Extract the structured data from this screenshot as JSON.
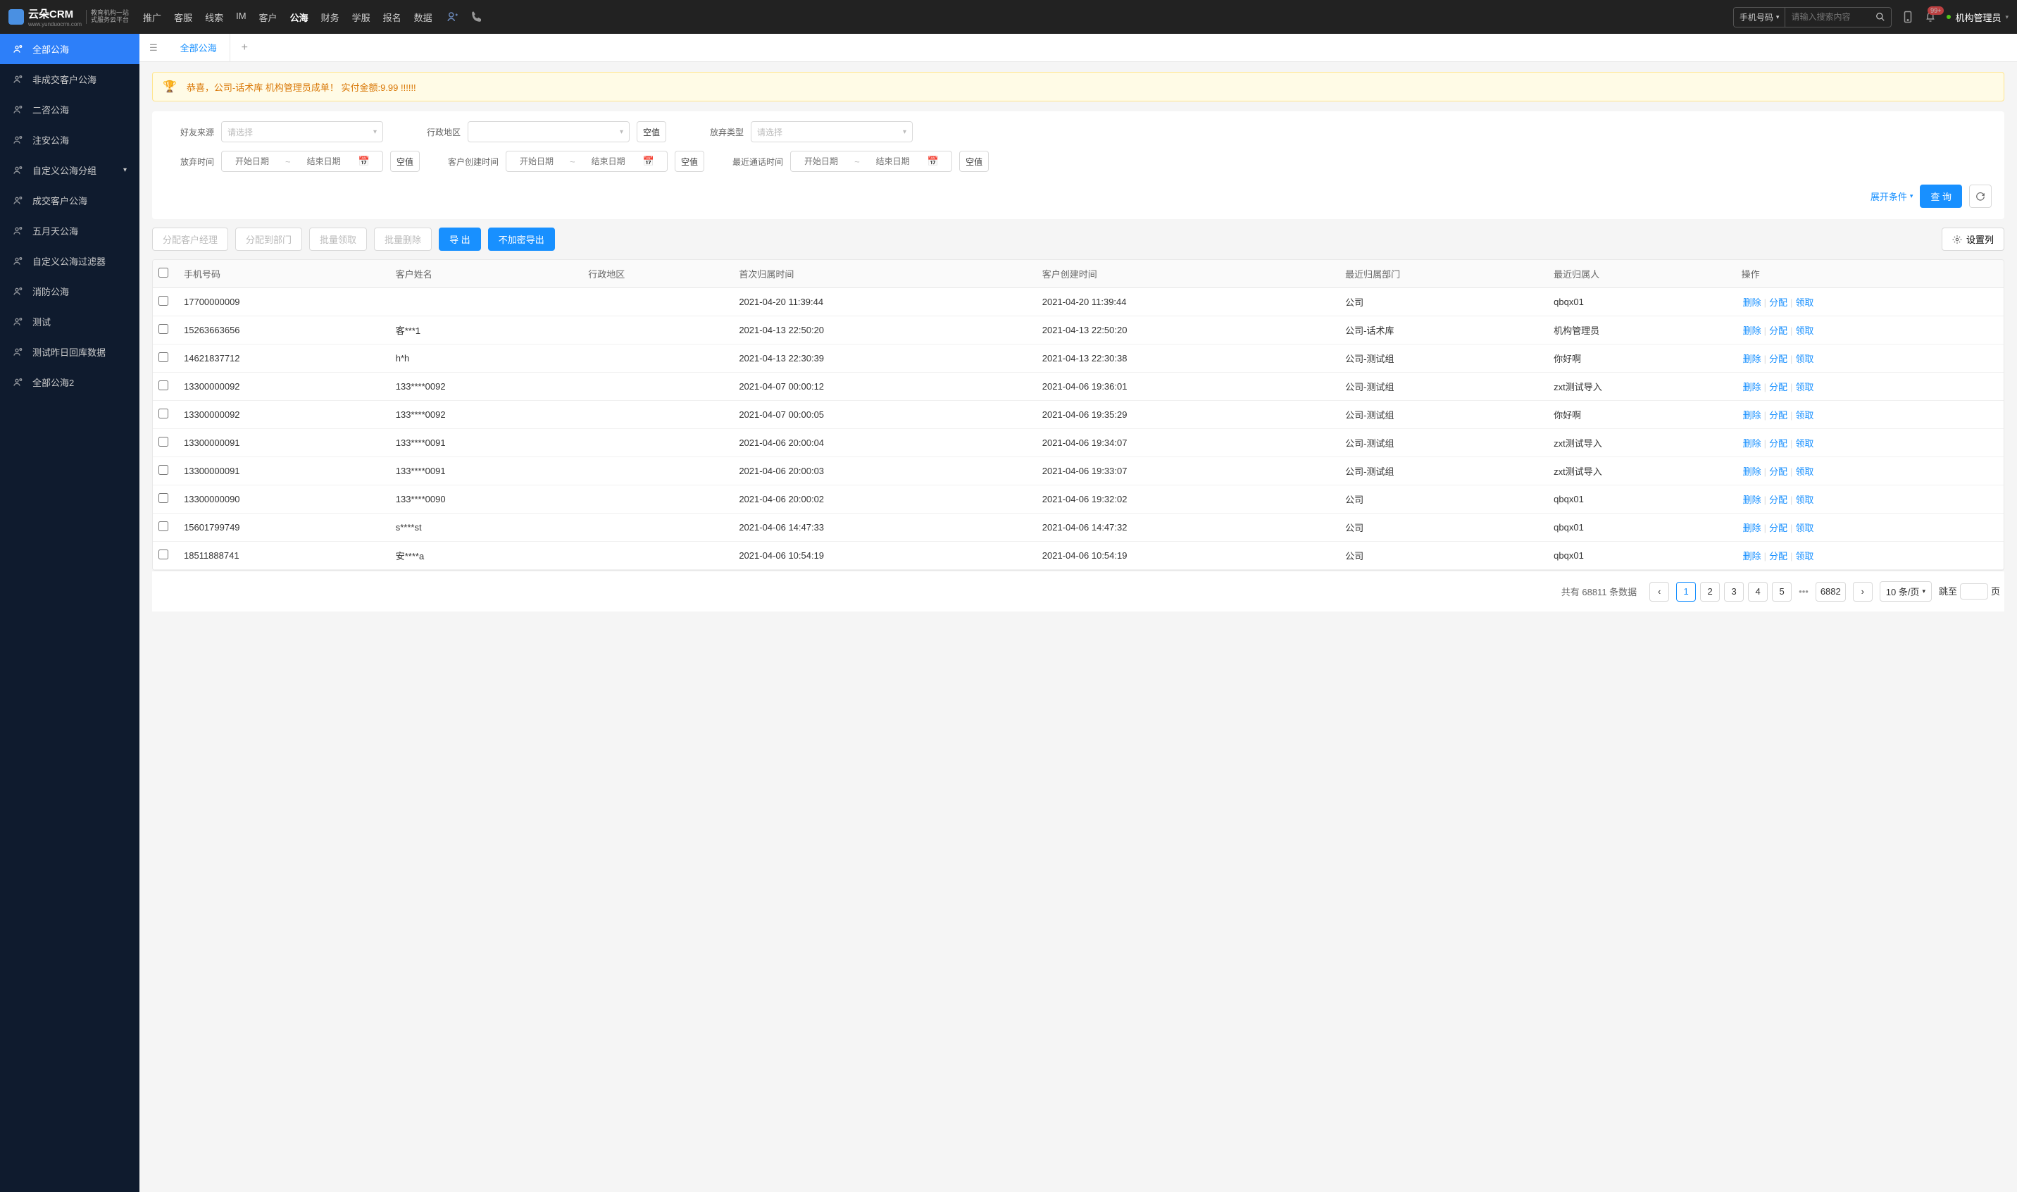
{
  "header": {
    "logo_main": "云朵CRM",
    "logo_sub1": "教育机构一站",
    "logo_sub2": "式服务云平台",
    "logo_url": "www.yunduocrm.com",
    "nav": [
      "推广",
      "客服",
      "线索",
      "IM",
      "客户",
      "公海",
      "财务",
      "学服",
      "报名",
      "数据"
    ],
    "nav_active_index": 5,
    "search_type": "手机号码",
    "search_placeholder": "请输入搜索内容",
    "badge_count": "99+",
    "user_name": "机构管理员"
  },
  "sidebar": [
    {
      "label": "全部公海",
      "active": true
    },
    {
      "label": "非成交客户公海"
    },
    {
      "label": "二咨公海"
    },
    {
      "label": "注安公海"
    },
    {
      "label": "自定义公海分组",
      "has_sub": true
    },
    {
      "label": "成交客户公海"
    },
    {
      "label": "五月天公海"
    },
    {
      "label": "自定义公海过滤器"
    },
    {
      "label": "消防公海"
    },
    {
      "label": "测试"
    },
    {
      "label": "测试昨日回库数据"
    },
    {
      "label": "全部公海2"
    }
  ],
  "tab": {
    "title": "全部公海"
  },
  "alert": "恭喜，公司-话术库  机构管理员成单！  实付金额:9.99 !!!!!!",
  "filters": {
    "friend_source_label": "好友来源",
    "friend_source_ph": "请选择",
    "admin_area_label": "行政地区",
    "admin_area_ph": "",
    "abandon_type_label": "放弃类型",
    "abandon_type_ph": "请选择",
    "abandon_time_label": "放弃时间",
    "create_time_label": "客户创建时间",
    "last_call_label": "最近通话时间",
    "date_start_ph": "开始日期",
    "date_end_ph": "结束日期",
    "null_btn": "空值",
    "expand": "展开条件",
    "query": "查 询"
  },
  "toolbar": {
    "assign_mgr": "分配客户经理",
    "assign_dept": "分配到部门",
    "batch_claim": "批量领取",
    "batch_delete": "批量删除",
    "export": "导 出",
    "export_plain": "不加密导出",
    "set_cols": "设置列"
  },
  "columns": [
    "手机号码",
    "客户姓名",
    "行政地区",
    "首次归属时间",
    "客户创建时间",
    "最近归属部门",
    "最近归属人",
    "操作"
  ],
  "rows": [
    {
      "phone": "17700000009",
      "name": "",
      "area": "",
      "first": "2021-04-20 11:39:44",
      "create": "2021-04-20 11:39:44",
      "dept": "公司",
      "owner": "qbqx01"
    },
    {
      "phone": "15263663656",
      "name": "客***1",
      "area": "",
      "first": "2021-04-13 22:50:20",
      "create": "2021-04-13 22:50:20",
      "dept": "公司-话术库",
      "owner": "机构管理员"
    },
    {
      "phone": "14621837712",
      "name": "h*h",
      "area": "",
      "first": "2021-04-13 22:30:39",
      "create": "2021-04-13 22:30:38",
      "dept": "公司-测试组",
      "owner": "你好啊"
    },
    {
      "phone": "13300000092",
      "name": "133****0092",
      "area": "",
      "first": "2021-04-07 00:00:12",
      "create": "2021-04-06 19:36:01",
      "dept": "公司-测试组",
      "owner": "zxt测试导入"
    },
    {
      "phone": "13300000092",
      "name": "133****0092",
      "area": "",
      "first": "2021-04-07 00:00:05",
      "create": "2021-04-06 19:35:29",
      "dept": "公司-测试组",
      "owner": "你好啊"
    },
    {
      "phone": "13300000091",
      "name": "133****0091",
      "area": "",
      "first": "2021-04-06 20:00:04",
      "create": "2021-04-06 19:34:07",
      "dept": "公司-测试组",
      "owner": "zxt测试导入"
    },
    {
      "phone": "13300000091",
      "name": "133****0091",
      "area": "",
      "first": "2021-04-06 20:00:03",
      "create": "2021-04-06 19:33:07",
      "dept": "公司-测试组",
      "owner": "zxt测试导入"
    },
    {
      "phone": "13300000090",
      "name": "133****0090",
      "area": "",
      "first": "2021-04-06 20:00:02",
      "create": "2021-04-06 19:32:02",
      "dept": "公司",
      "owner": "qbqx01"
    },
    {
      "phone": "15601799749",
      "name": "s****st",
      "area": "",
      "first": "2021-04-06 14:47:33",
      "create": "2021-04-06 14:47:32",
      "dept": "公司",
      "owner": "qbqx01"
    },
    {
      "phone": "18511888741",
      "name": "安****a",
      "area": "",
      "first": "2021-04-06 10:54:19",
      "create": "2021-04-06 10:54:19",
      "dept": "公司",
      "owner": "qbqx01"
    }
  ],
  "ops": {
    "del": "删除",
    "assign": "分配",
    "claim": "领取"
  },
  "pagination": {
    "total_prefix": "共有 ",
    "total": "68811",
    "total_suffix": " 条数据",
    "pages": [
      "1",
      "2",
      "3",
      "4",
      "5"
    ],
    "last": "6882",
    "per_page": "10 条/页",
    "jump_label": "跳至",
    "page_suffix": "页"
  }
}
